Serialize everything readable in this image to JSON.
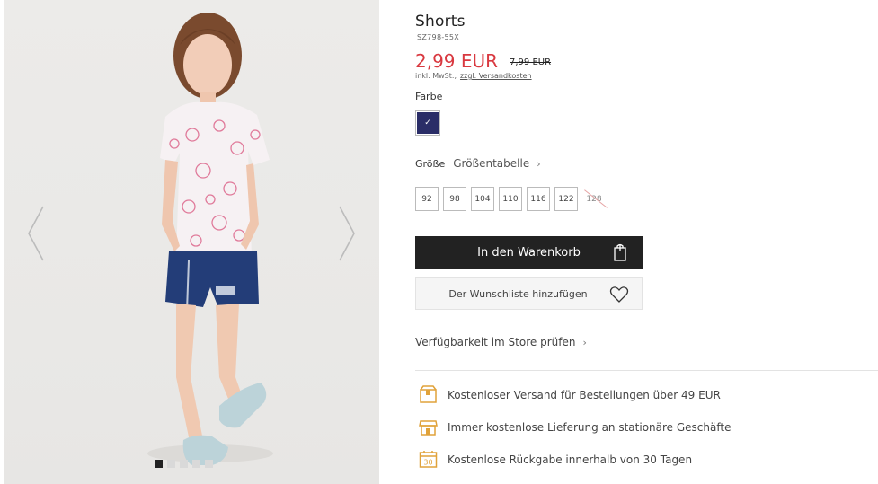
{
  "product": {
    "title": "Shorts",
    "sku": "SZ798-55X",
    "price": "2,99 EUR",
    "old_price": "7,99 EUR",
    "vat_note": "inkl. MwSt.,",
    "shipping_link": "zzgl. Versandkosten"
  },
  "color": {
    "label": "Farbe",
    "selected_hex": "#2a2d67",
    "check": "✓"
  },
  "size": {
    "label": "Größe",
    "guide_link": "Größentabelle",
    "options": [
      "92",
      "98",
      "104",
      "110",
      "116",
      "122",
      "128"
    ]
  },
  "actions": {
    "cart_label": "In den Warenkorb",
    "wishlist_label": "Der Wunschliste hinzufügen",
    "store_availability": "Verfügbarkeit im Store prüfen"
  },
  "benefits": [
    {
      "icon": "delivery-box-icon",
      "text": "Kostenloser Versand für Bestellungen über 49 EUR"
    },
    {
      "icon": "store-icon",
      "text": "Immer kostenlose Lieferung an stationäre Geschäfte"
    },
    {
      "icon": "calendar-30-icon",
      "text": "Kostenlose Rückgabe innerhalb von 30 Tagen"
    }
  ],
  "calendar_icon_number": "30",
  "colors": {
    "price_red": "#d93940",
    "benefit_icon": "#e0a23a",
    "button_dark": "#222222"
  }
}
